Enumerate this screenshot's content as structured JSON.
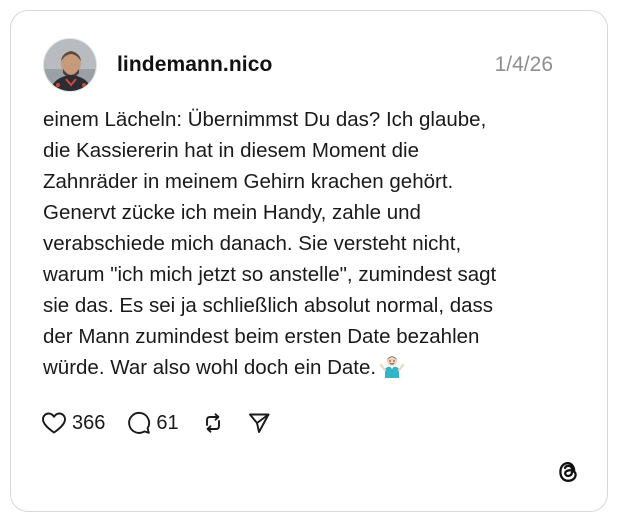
{
  "post": {
    "username": "lindemann.nico",
    "date": "1/4/26",
    "text": "einem Lächeln: Übernimmst Du das? Ich glaube,\ndie Kassiererin hat in diesem Moment die\nZahnräder in meinem Gehirn krachen gehört.\nGenervt zücke ich mein Handy, zahle und\nverabschiede mich danach. Sie versteht nicht,\nwarum \"ich mich jetzt so anstelle\", zumindest sagt\nsie das. Es sei ja schließlich absolut normal, dass\nder Mann zumindest beim ersten Date bezahlen\nwürde. War also wohl doch ein Date.",
    "trailing_emoji": "person-shrugging-emoji"
  },
  "actions": {
    "like": {
      "icon": "heart-icon",
      "count": "366"
    },
    "reply": {
      "icon": "comment-icon",
      "count": "61"
    },
    "repost": {
      "icon": "repost-icon"
    },
    "share": {
      "icon": "send-icon"
    }
  },
  "brand": {
    "icon": "threads-logo-icon"
  },
  "colors": {
    "text": "#1a1a1a",
    "muted": "#8e8e8e",
    "border": "#d9d9d9",
    "background": "#ffffff"
  }
}
